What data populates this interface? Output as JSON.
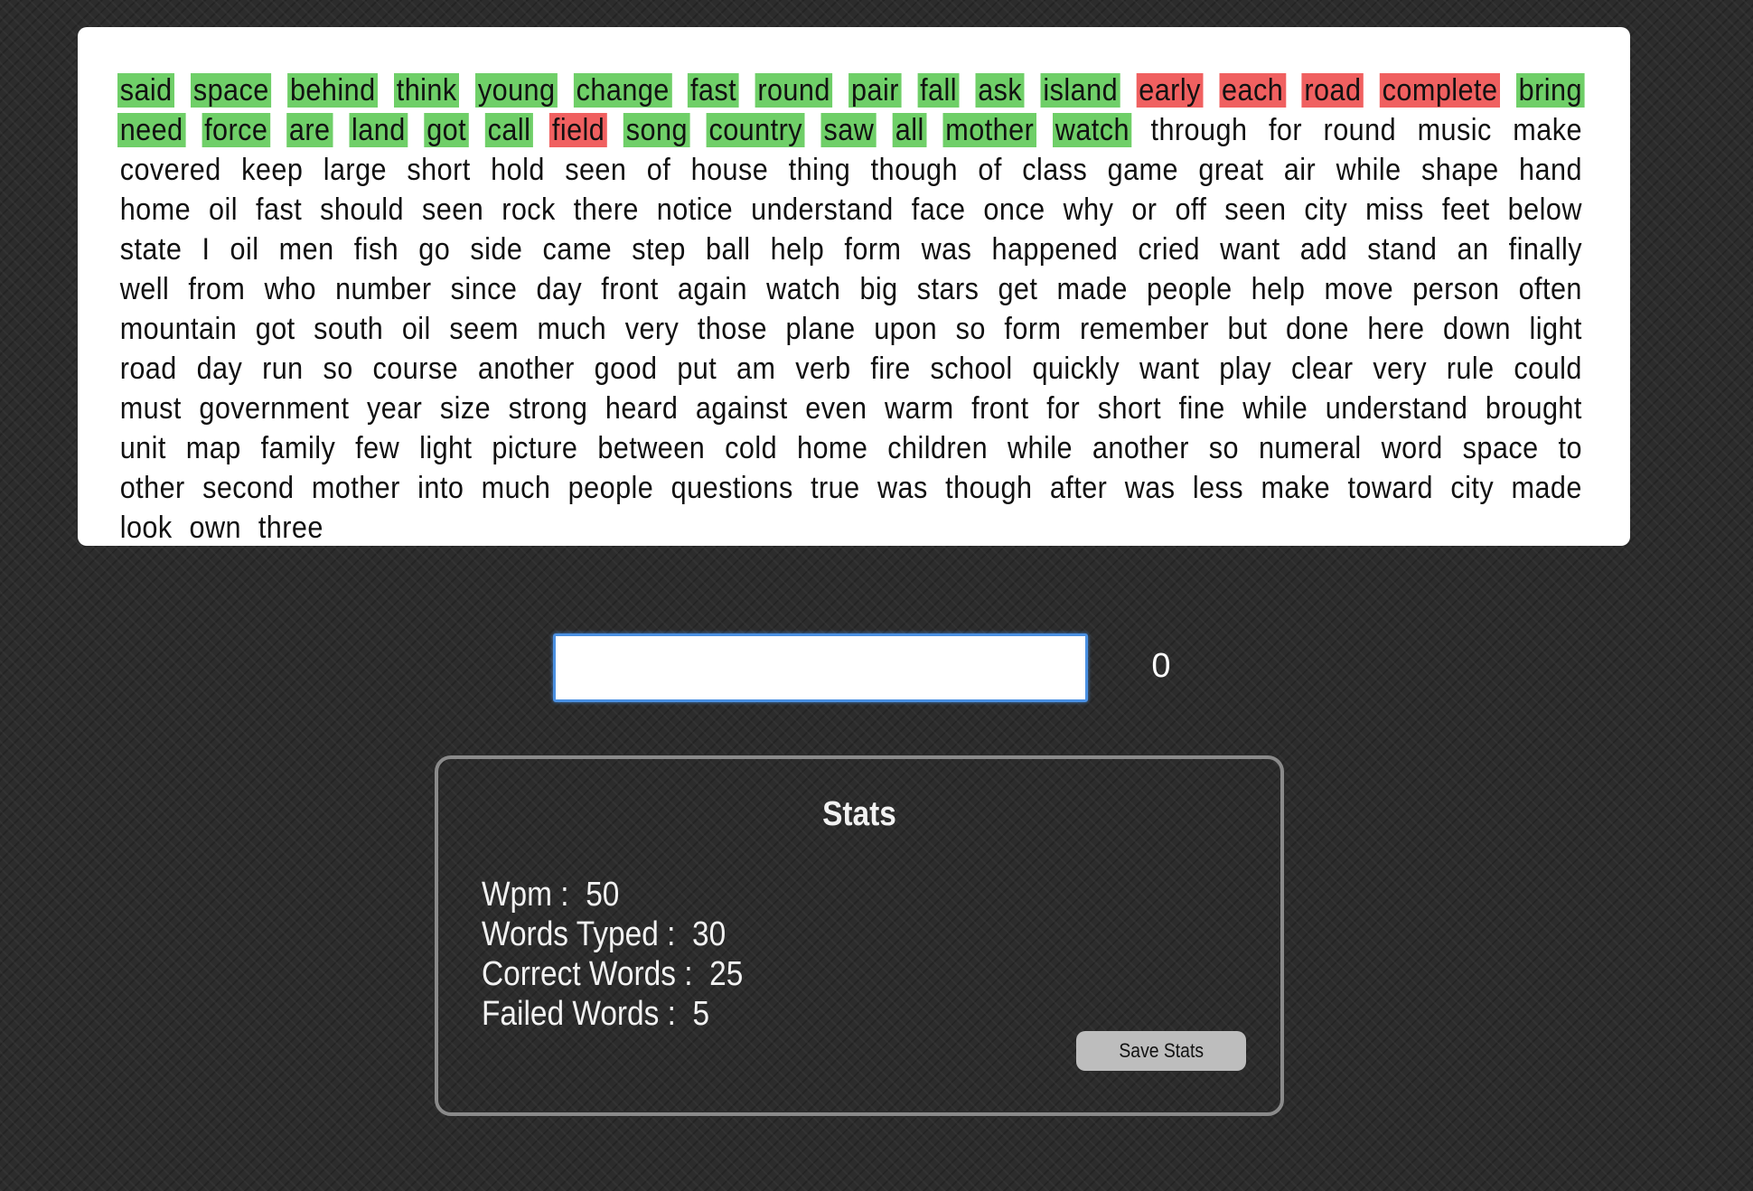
{
  "passage": {
    "words": [
      {
        "text": "said",
        "status": "correct"
      },
      {
        "text": "space",
        "status": "correct"
      },
      {
        "text": "behind",
        "status": "correct"
      },
      {
        "text": "think",
        "status": "correct"
      },
      {
        "text": "young",
        "status": "correct"
      },
      {
        "text": "change",
        "status": "correct"
      },
      {
        "text": "fast",
        "status": "correct"
      },
      {
        "text": "round",
        "status": "correct"
      },
      {
        "text": "pair",
        "status": "correct"
      },
      {
        "text": "fall",
        "status": "correct"
      },
      {
        "text": "ask",
        "status": "correct"
      },
      {
        "text": "island",
        "status": "correct"
      },
      {
        "text": "early",
        "status": "wrong"
      },
      {
        "text": "each",
        "status": "wrong"
      },
      {
        "text": "road",
        "status": "wrong"
      },
      {
        "text": "complete",
        "status": "wrong"
      },
      {
        "text": "bring",
        "status": "correct"
      },
      {
        "text": "need",
        "status": "correct"
      },
      {
        "text": "force",
        "status": "correct"
      },
      {
        "text": "are",
        "status": "correct"
      },
      {
        "text": "land",
        "status": "correct"
      },
      {
        "text": "got",
        "status": "correct"
      },
      {
        "text": "call",
        "status": "correct"
      },
      {
        "text": "field",
        "status": "wrong"
      },
      {
        "text": "song",
        "status": "correct"
      },
      {
        "text": "country",
        "status": "correct"
      },
      {
        "text": "saw",
        "status": "correct"
      },
      {
        "text": "all",
        "status": "correct"
      },
      {
        "text": "mother",
        "status": "correct"
      },
      {
        "text": "watch",
        "status": "correct"
      },
      {
        "text": "through",
        "status": "pending"
      },
      {
        "text": "for",
        "status": "pending"
      },
      {
        "text": "round",
        "status": "pending"
      },
      {
        "text": "music",
        "status": "pending"
      },
      {
        "text": "make",
        "status": "pending"
      },
      {
        "text": "covered",
        "status": "pending"
      },
      {
        "text": "keep",
        "status": "pending"
      },
      {
        "text": "large",
        "status": "pending"
      },
      {
        "text": "short",
        "status": "pending"
      },
      {
        "text": "hold",
        "status": "pending"
      },
      {
        "text": "seen",
        "status": "pending"
      },
      {
        "text": "of",
        "status": "pending"
      },
      {
        "text": "house",
        "status": "pending"
      },
      {
        "text": "thing",
        "status": "pending"
      },
      {
        "text": "though",
        "status": "pending"
      },
      {
        "text": "of",
        "status": "pending"
      },
      {
        "text": "class",
        "status": "pending"
      },
      {
        "text": "game",
        "status": "pending"
      },
      {
        "text": "great",
        "status": "pending"
      },
      {
        "text": "air",
        "status": "pending"
      },
      {
        "text": "while",
        "status": "pending"
      },
      {
        "text": "shape",
        "status": "pending"
      },
      {
        "text": "hand",
        "status": "pending"
      },
      {
        "text": "home",
        "status": "pending"
      },
      {
        "text": "oil",
        "status": "pending"
      },
      {
        "text": "fast",
        "status": "pending"
      },
      {
        "text": "should",
        "status": "pending"
      },
      {
        "text": "seen",
        "status": "pending"
      },
      {
        "text": "rock",
        "status": "pending"
      },
      {
        "text": "there",
        "status": "pending"
      },
      {
        "text": "notice",
        "status": "pending"
      },
      {
        "text": "understand",
        "status": "pending"
      },
      {
        "text": "face",
        "status": "pending"
      },
      {
        "text": "once",
        "status": "pending"
      },
      {
        "text": "why",
        "status": "pending"
      },
      {
        "text": "or",
        "status": "pending"
      },
      {
        "text": "off",
        "status": "pending"
      },
      {
        "text": "seen",
        "status": "pending"
      },
      {
        "text": "city",
        "status": "pending"
      },
      {
        "text": "miss",
        "status": "pending"
      },
      {
        "text": "feet",
        "status": "pending"
      },
      {
        "text": "below",
        "status": "pending"
      },
      {
        "text": "state",
        "status": "pending"
      },
      {
        "text": "I",
        "status": "pending"
      },
      {
        "text": "oil",
        "status": "pending"
      },
      {
        "text": "men",
        "status": "pending"
      },
      {
        "text": "fish",
        "status": "pending"
      },
      {
        "text": "go",
        "status": "pending"
      },
      {
        "text": "side",
        "status": "pending"
      },
      {
        "text": "came",
        "status": "pending"
      },
      {
        "text": "step",
        "status": "pending"
      },
      {
        "text": "ball",
        "status": "pending"
      },
      {
        "text": "help",
        "status": "pending"
      },
      {
        "text": "form",
        "status": "pending"
      },
      {
        "text": "was",
        "status": "pending"
      },
      {
        "text": "happened",
        "status": "pending"
      },
      {
        "text": "cried",
        "status": "pending"
      },
      {
        "text": "want",
        "status": "pending"
      },
      {
        "text": "add",
        "status": "pending"
      },
      {
        "text": "stand",
        "status": "pending"
      },
      {
        "text": "an",
        "status": "pending"
      },
      {
        "text": "finally",
        "status": "pending"
      },
      {
        "text": "well",
        "status": "pending"
      },
      {
        "text": "from",
        "status": "pending"
      },
      {
        "text": "who",
        "status": "pending"
      },
      {
        "text": "number",
        "status": "pending"
      },
      {
        "text": "since",
        "status": "pending"
      },
      {
        "text": "day",
        "status": "pending"
      },
      {
        "text": "front",
        "status": "pending"
      },
      {
        "text": "again",
        "status": "pending"
      },
      {
        "text": "watch",
        "status": "pending"
      },
      {
        "text": "big",
        "status": "pending"
      },
      {
        "text": "stars",
        "status": "pending"
      },
      {
        "text": "get",
        "status": "pending"
      },
      {
        "text": "made",
        "status": "pending"
      },
      {
        "text": "people",
        "status": "pending"
      },
      {
        "text": "help",
        "status": "pending"
      },
      {
        "text": "move",
        "status": "pending"
      },
      {
        "text": "person",
        "status": "pending"
      },
      {
        "text": "often",
        "status": "pending"
      },
      {
        "text": "mountain",
        "status": "pending"
      },
      {
        "text": "got",
        "status": "pending"
      },
      {
        "text": "south",
        "status": "pending"
      },
      {
        "text": "oil",
        "status": "pending"
      },
      {
        "text": "seem",
        "status": "pending"
      },
      {
        "text": "much",
        "status": "pending"
      },
      {
        "text": "very",
        "status": "pending"
      },
      {
        "text": "those",
        "status": "pending"
      },
      {
        "text": "plane",
        "status": "pending"
      },
      {
        "text": "upon",
        "status": "pending"
      },
      {
        "text": "so",
        "status": "pending"
      },
      {
        "text": "form",
        "status": "pending"
      },
      {
        "text": "remember",
        "status": "pending"
      },
      {
        "text": "but",
        "status": "pending"
      },
      {
        "text": "done",
        "status": "pending"
      },
      {
        "text": "here",
        "status": "pending"
      },
      {
        "text": "down",
        "status": "pending"
      },
      {
        "text": "light",
        "status": "pending"
      },
      {
        "text": "road",
        "status": "pending"
      },
      {
        "text": "day",
        "status": "pending"
      },
      {
        "text": "run",
        "status": "pending"
      },
      {
        "text": "so",
        "status": "pending"
      },
      {
        "text": "course",
        "status": "pending"
      },
      {
        "text": "another",
        "status": "pending"
      },
      {
        "text": "good",
        "status": "pending"
      },
      {
        "text": "put",
        "status": "pending"
      },
      {
        "text": "am",
        "status": "pending"
      },
      {
        "text": "verb",
        "status": "pending"
      },
      {
        "text": "fire",
        "status": "pending"
      },
      {
        "text": "school",
        "status": "pending"
      },
      {
        "text": "quickly",
        "status": "pending"
      },
      {
        "text": "want",
        "status": "pending"
      },
      {
        "text": "play",
        "status": "pending"
      },
      {
        "text": "clear",
        "status": "pending"
      },
      {
        "text": "very",
        "status": "pending"
      },
      {
        "text": "rule",
        "status": "pending"
      },
      {
        "text": "could",
        "status": "pending"
      },
      {
        "text": "must",
        "status": "pending"
      },
      {
        "text": "government",
        "status": "pending"
      },
      {
        "text": "year",
        "status": "pending"
      },
      {
        "text": "size",
        "status": "pending"
      },
      {
        "text": "strong",
        "status": "pending"
      },
      {
        "text": "heard",
        "status": "pending"
      },
      {
        "text": "against",
        "status": "pending"
      },
      {
        "text": "even",
        "status": "pending"
      },
      {
        "text": "warm",
        "status": "pending"
      },
      {
        "text": "front",
        "status": "pending"
      },
      {
        "text": "for",
        "status": "pending"
      },
      {
        "text": "short",
        "status": "pending"
      },
      {
        "text": "fine",
        "status": "pending"
      },
      {
        "text": "while",
        "status": "pending"
      },
      {
        "text": "understand",
        "status": "pending"
      },
      {
        "text": "brought",
        "status": "pending"
      },
      {
        "text": "unit",
        "status": "pending"
      },
      {
        "text": "map",
        "status": "pending"
      },
      {
        "text": "family",
        "status": "pending"
      },
      {
        "text": "few",
        "status": "pending"
      },
      {
        "text": "light",
        "status": "pending"
      },
      {
        "text": "picture",
        "status": "pending"
      },
      {
        "text": "between",
        "status": "pending"
      },
      {
        "text": "cold",
        "status": "pending"
      },
      {
        "text": "home",
        "status": "pending"
      },
      {
        "text": "children",
        "status": "pending"
      },
      {
        "text": "while",
        "status": "pending"
      },
      {
        "text": "another",
        "status": "pending"
      },
      {
        "text": "so",
        "status": "pending"
      },
      {
        "text": "numeral",
        "status": "pending"
      },
      {
        "text": "word",
        "status": "pending"
      },
      {
        "text": "space",
        "status": "pending"
      },
      {
        "text": "to",
        "status": "pending"
      },
      {
        "text": "other",
        "status": "pending"
      },
      {
        "text": "second",
        "status": "pending"
      },
      {
        "text": "mother",
        "status": "pending"
      },
      {
        "text": "into",
        "status": "pending"
      },
      {
        "text": "much",
        "status": "pending"
      },
      {
        "text": "people",
        "status": "pending"
      },
      {
        "text": "questions",
        "status": "pending"
      },
      {
        "text": "true",
        "status": "pending"
      },
      {
        "text": "was",
        "status": "pending"
      },
      {
        "text": "though",
        "status": "pending"
      },
      {
        "text": "after",
        "status": "pending"
      },
      {
        "text": "was",
        "status": "pending"
      },
      {
        "text": "less",
        "status": "pending"
      },
      {
        "text": "make",
        "status": "pending"
      },
      {
        "text": "toward",
        "status": "pending"
      },
      {
        "text": "city",
        "status": "pending"
      },
      {
        "text": "made",
        "status": "pending"
      },
      {
        "text": "look",
        "status": "pending"
      },
      {
        "text": "own",
        "status": "pending"
      },
      {
        "text": "three",
        "status": "pending"
      }
    ]
  },
  "typing": {
    "input_value": "",
    "timer": "0"
  },
  "stats": {
    "title": "Stats",
    "rows": [
      {
        "label": "Wpm :",
        "value": "50"
      },
      {
        "label": "Words Typed :",
        "value": "30"
      },
      {
        "label": "Correct Words :",
        "value": "25"
      },
      {
        "label": "Failed Words :",
        "value": "5"
      }
    ],
    "save_label": "Save Stats"
  },
  "colors": {
    "background": "#2c2c2c",
    "correct_highlight": "#6fcf68",
    "wrong_highlight": "#f06060",
    "input_focus_border": "#4a90e2",
    "stats_border": "#8a8a8a",
    "button_bg": "#bdbdbd"
  }
}
